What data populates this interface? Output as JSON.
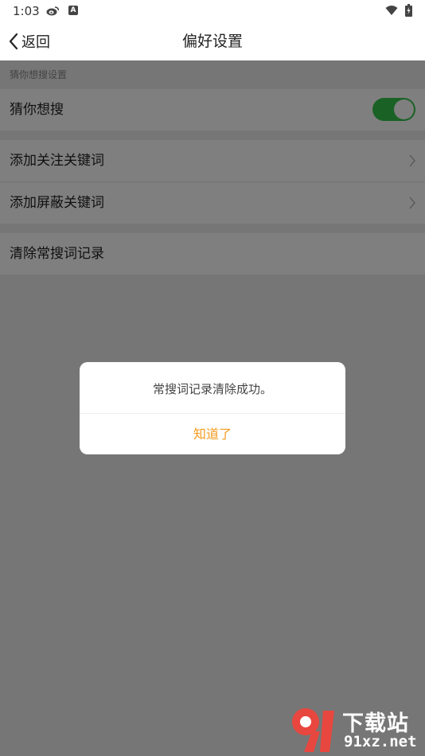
{
  "status_bar": {
    "time": "1:03"
  },
  "header": {
    "back_label": "返回",
    "title": "偏好设置"
  },
  "section1": {
    "header": "猜你想搜设置",
    "toggle_row_label": "猜你想搜",
    "toggle_on": true
  },
  "section2": {
    "items": [
      {
        "label": "添加关注关键词"
      },
      {
        "label": "添加屏蔽关键词"
      }
    ]
  },
  "section3": {
    "items": [
      {
        "label": "清除常搜词记录"
      }
    ]
  },
  "dialog": {
    "message": "常搜词记录清除成功。",
    "button_label": "知道了"
  },
  "watermark": {
    "name": "下载站",
    "url": "91xz.net"
  },
  "colors": {
    "toggle_green": "#34c34a",
    "dialog_button": "#f39a1e",
    "watermark_red": "#e8473f"
  }
}
